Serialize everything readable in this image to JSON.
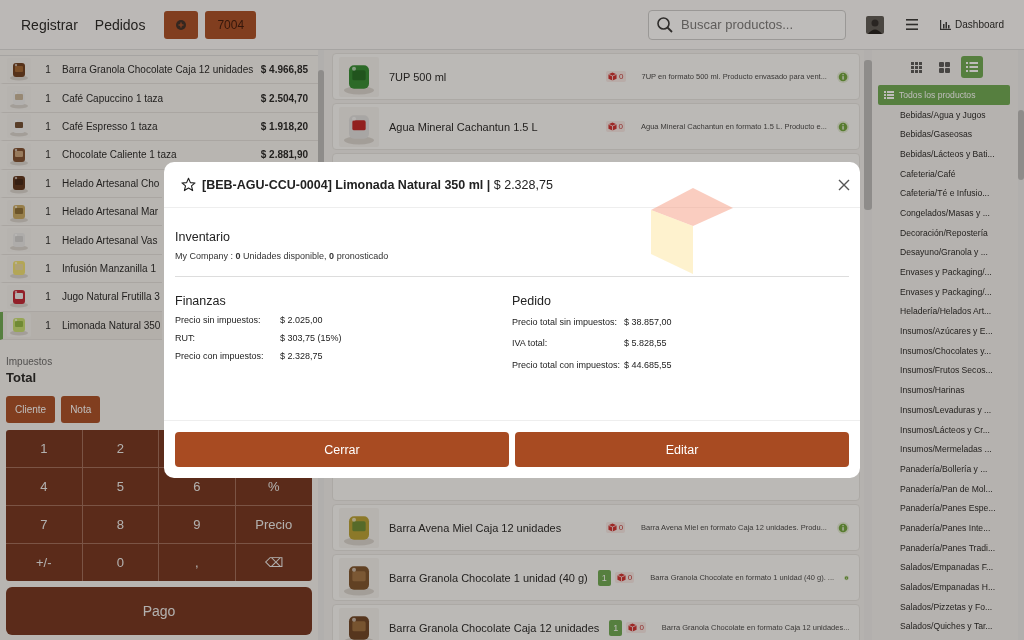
{
  "topbar": {
    "nav": [
      "Registrar",
      "Pedidos"
    ],
    "order_button": "7004",
    "search": {
      "placeholder": "Buscar productos..."
    },
    "dashboard": "Dashboard"
  },
  "order_lines": [
    {
      "qty": "1",
      "name": "Barra Granola Chocolate Caja 12 unidades",
      "price": "$ 4.966,85",
      "selected": false
    },
    {
      "qty": "1",
      "name": "Café Capuccino 1 taza",
      "price": "$ 2.504,70",
      "selected": false
    },
    {
      "qty": "1",
      "name": "Café Espresso 1 taza",
      "price": "$ 1.918,20",
      "selected": false
    },
    {
      "qty": "1",
      "name": "Chocolate Caliente 1 taza",
      "price": "$ 2.881,90",
      "selected": false
    },
    {
      "qty": "1",
      "name": "Helado Artesanal Cho",
      "selected": false
    },
    {
      "qty": "1",
      "name": "Helado Artesanal Mar",
      "selected": false
    },
    {
      "qty": "1",
      "name": "Helado Artesanal Vas",
      "selected": false
    },
    {
      "qty": "1",
      "name": "Infusión Manzanilla 1",
      "selected": false
    },
    {
      "qty": "1",
      "name": "Jugo Natural Frutilla 3",
      "selected": false
    },
    {
      "qty": "1",
      "name": "Limonada Natural 350",
      "selected": true
    }
  ],
  "summary": {
    "taxes_label": "Impuestos",
    "total_label": "Total"
  },
  "actions": [
    "Cliente",
    "Nota"
  ],
  "numpad": [
    [
      "1",
      "2"
    ],
    [
      "4",
      "5",
      "6",
      "%"
    ],
    [
      "7",
      "8",
      "9",
      "Precio"
    ],
    [
      "+/-",
      "0",
      ",",
      "⌫"
    ]
  ],
  "pay_button": "Pago",
  "products_top": [
    {
      "name": "7UP 500 ml",
      "stock": "0",
      "description": "7UP en formato 500 ml. Producto envasado para vent..."
    },
    {
      "name": "Agua Mineral Cachantun 1.5 L",
      "stock": "0",
      "description": "Agua Mineral Cachantun en formato 1.5 L. Producto e..."
    }
  ],
  "products_bottom": [
    {
      "name": "Barra Avena Miel Caja 12 unidades",
      "stock": "0",
      "description": "Barra Avena Miel en formato Caja 12 unidades. Produ..."
    },
    {
      "name": "Barra Granola Chocolate 1 unidad (40 g)",
      "in_cart": "1",
      "stock": "0",
      "description": "Barra Granola Chocolate en formato 1 unidad (40 g). ..."
    },
    {
      "name": "Barra Granola Chocolate Caja 12 unidades",
      "in_cart": "1",
      "stock": "0",
      "description": "Barra Granola Chocolate en formato Caja 12 unidades..."
    }
  ],
  "view_modes": [
    {
      "kind": "small-grid",
      "selected": false
    },
    {
      "kind": "large-grid",
      "selected": false
    },
    {
      "kind": "list",
      "selected": true
    }
  ],
  "categories": [
    {
      "label": "Todos los productos",
      "selected": true
    },
    {
      "label": "Bebidas/Agua y Jugos",
      "selected": false
    },
    {
      "label": "Bebidas/Gaseosas",
      "selected": false
    },
    {
      "label": "Bebidas/Lácteos y Bati...",
      "selected": false
    },
    {
      "label": "Cafeteria/Café",
      "selected": false
    },
    {
      "label": "Cafeteria/Té e Infusio...",
      "selected": false
    },
    {
      "label": "Congelados/Masas y ...",
      "selected": false
    },
    {
      "label": "Decoración/Repostería",
      "selected": false
    },
    {
      "label": "Desayuno/Granola y ...",
      "selected": false
    },
    {
      "label": "Envases y Packaging/...",
      "selected": false
    },
    {
      "label": "Envases y Packaging/...",
      "selected": false
    },
    {
      "label": "Heladería/Helados Art...",
      "selected": false
    },
    {
      "label": "Insumos/Azúcares y E...",
      "selected": false
    },
    {
      "label": "Insumos/Chocolates y...",
      "selected": false
    },
    {
      "label": "Insumos/Frutos Secos...",
      "selected": false
    },
    {
      "label": "Insumos/Harinas",
      "selected": false
    },
    {
      "label": "Insumos/Levaduras y ...",
      "selected": false
    },
    {
      "label": "Insumos/Lácteos y Cr...",
      "selected": false
    },
    {
      "label": "Insumos/Mermeladas ...",
      "selected": false
    },
    {
      "label": "Panadería/Bollería y ...",
      "selected": false
    },
    {
      "label": "Panadería/Pan de Mol...",
      "selected": false
    },
    {
      "label": "Panadería/Panes Espe...",
      "selected": false
    },
    {
      "label": "Panadería/Panes Inte...",
      "selected": false
    },
    {
      "label": "Panadería/Panes Tradi...",
      "selected": false
    },
    {
      "label": "Salados/Empanadas F...",
      "selected": false
    },
    {
      "label": "Salados/Empanadas H...",
      "selected": false
    },
    {
      "label": "Salados/Pizzetas y Fo...",
      "selected": false
    },
    {
      "label": "Salados/Quiches y Tar...",
      "selected": false
    }
  ],
  "modal": {
    "title": "**[BEB-AGU-CCU-0004] Limonada Natural 350 ml |** $ 2.328,75",
    "favorite": false,
    "inventory": {
      "heading": "Inventario",
      "line": "My Company :  **0** Unidades disponible,  **0**  pronosticado"
    },
    "finance": {
      "heading": "Finanzas",
      "rows": [
        {
          "label": "Precio sin impuestos:",
          "value": "$ 2.025,00"
        },
        {
          "label": "RUT:",
          "value": "$ 303,75 (15%)"
        },
        {
          "label": "Precio con impuestos:",
          "value": "$ 2.328,75"
        }
      ]
    },
    "order": {
      "heading": "Pedido",
      "rows": [
        {
          "label": "Precio total sin impuestos:",
          "value": "$ 38.857,00"
        },
        {
          "label": "IVA total:",
          "value": "$ 5.828,55"
        },
        {
          "label": "Precio total con impuestos:",
          "value": "$ 44.685,55"
        }
      ]
    },
    "buttons": [
      "Cerrar",
      "Editar"
    ]
  }
}
